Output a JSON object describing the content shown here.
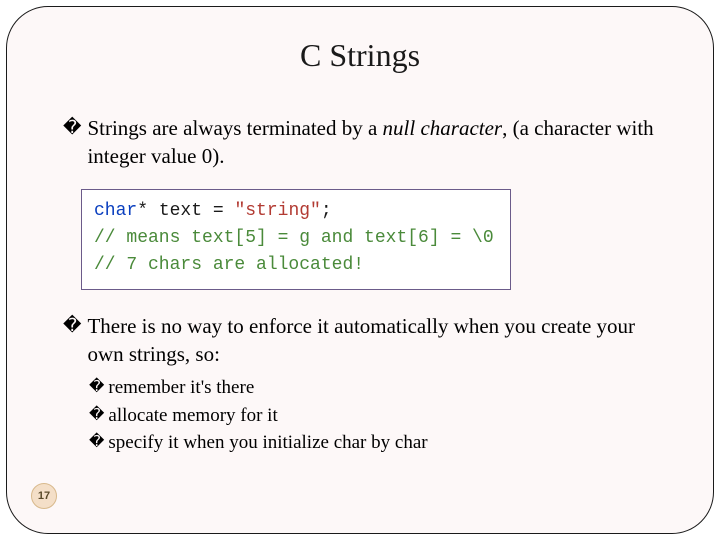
{
  "title": "C Strings",
  "bullets": [
    {
      "pre": "Strings are always terminated by a ",
      "em": "null character",
      "post": ", (a character with integer value 0)."
    },
    {
      "pre": "There is no way to enforce it automatically when you create your own strings, so:",
      "em": "",
      "post": ""
    }
  ],
  "code": {
    "l1": {
      "kw": "char",
      "rest": "* text = ",
      "str": "\"string\"",
      "end": ";"
    },
    "l2": "// means text[5] = g and text[6] = \\0",
    "l3": "// 7 chars are allocated!"
  },
  "sub": [
    "remember it's there",
    "allocate memory for it",
    "specify it when you initialize char by char"
  ],
  "glyph": "�",
  "page": "17"
}
